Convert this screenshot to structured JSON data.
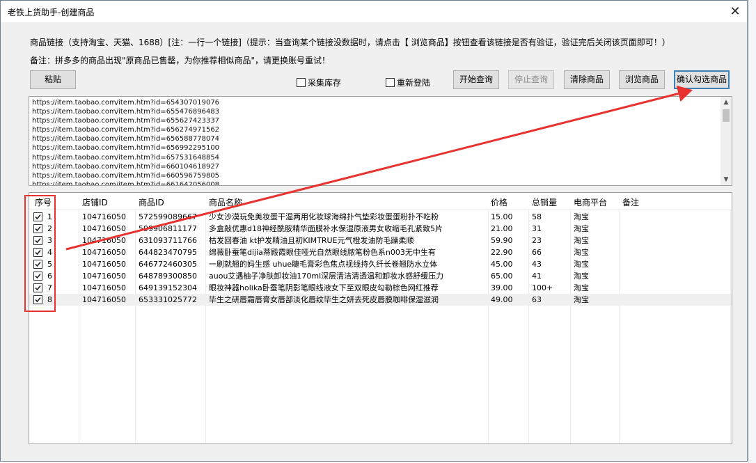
{
  "window": {
    "title": "老铁上货助手-创建商品",
    "close_glyph": "✕"
  },
  "notes": {
    "line1": "商品链接（支持淘宝、天猫、1688）[注：一行一个链接]（提示：当查询某个链接没数据时，请点击【 浏览商品】按钮查看该链接是否有验证，验证完后关闭该页面即可！）",
    "line2": "备注：拼多多的商品出现\"原商品已售罄，为你推荐相似商品\"，请更换账号重试！"
  },
  "toolbar": {
    "paste": "粘贴",
    "collect_stock": "采集库存",
    "relogin": "重新登陆",
    "start_query": "开始查询",
    "stop_query": "停止查询",
    "clear_goods": "清除商品",
    "browse_goods": "浏览商品",
    "confirm_selected": "确认勾选商品"
  },
  "urls": [
    "https://item.taobao.com/item.htm?id=654307019076",
    "https://item.taobao.com/item.htm?id=655476896483",
    "https://item.taobao.com/item.htm?id=655627423337",
    "https://item.taobao.com/item.htm?id=656274971562",
    "https://item.taobao.com/item.htm?id=656588778074",
    "https://item.taobao.com/item.htm?id=656992295100",
    "https://item.taobao.com/item.htm?id=657531648854",
    "https://item.taobao.com/item.htm?id=660104618927",
    "https://item.taobao.com/item.htm?id=660596759805",
    "https://item.taobao.com/item.htm?id=661642056008"
  ],
  "table": {
    "headers": [
      "序号",
      "店铺ID",
      "商品ID",
      "商品名称",
      "价格",
      "总销量",
      "电商平台",
      "备注"
    ],
    "rows": [
      {
        "no": "1",
        "shop": "104716050",
        "item": "572599089667",
        "name": "少女沙漠玩免美妆蛋干湿两用化妆球海绵扑气垫彩妆蛋蛋粉扑不吃粉",
        "price": "15.00",
        "sales": "58",
        "platform": "淘宝",
        "note": ""
      },
      {
        "no": "2",
        "shop": "104716050",
        "item": "599906811177",
        "name": "多盒敲优惠d18神经酰胺精华面膜补水保湿原液男女收缩毛孔紧致5片",
        "price": "21.00",
        "sales": "31",
        "platform": "淘宝",
        "note": ""
      },
      {
        "no": "3",
        "shop": "104716050",
        "item": "631093711766",
        "name": "枯发回春油 kt护发精油且初KIMTRUE元气橙发油防毛躁柔顺",
        "price": "59.90",
        "sales": "23",
        "platform": "淘宝",
        "note": ""
      },
      {
        "no": "4",
        "shop": "104716050",
        "item": "644823470795",
        "name": "绵薇卧蚕笔dijia蒂殿霞眼佳哑光自然眼线脓笔粉色系n003无中生有",
        "price": "22.90",
        "sales": "66",
        "platform": "淘宝",
        "note": ""
      },
      {
        "no": "5",
        "shop": "104716050",
        "item": "646772460305",
        "name": "一刷就翘的妈生感 uhue睫毛膏彩色焦点视线持久纤长卷翘防水立体",
        "price": "45.00",
        "sales": "43",
        "platform": "淘宝",
        "note": ""
      },
      {
        "no": "6",
        "shop": "104716050",
        "item": "648789300850",
        "name": "auou艾遇柚子净肤卸妆油170ml深层清洁清透温和卸妆水感舒缓压力",
        "price": "65.00",
        "sales": "41",
        "platform": "淘宝",
        "note": ""
      },
      {
        "no": "7",
        "shop": "104716050",
        "item": "649139152304",
        "name": "眼妆神器holika卧蚕笔阴影笔眼线液女下至双眼皮勾勒棕色网红推荐",
        "price": "39.00",
        "sales": "100+",
        "platform": "淘宝",
        "note": ""
      },
      {
        "no": "8",
        "shop": "104716050",
        "item": "653331025772",
        "name": "毕生之研唇霜唇膏女唇部淡化唇纹毕生之妍去死皮唇膜咖啡保湿滋润",
        "price": "49.00",
        "sales": "63",
        "platform": "淘宝",
        "note": ""
      }
    ]
  },
  "colors": {
    "annotation": "#e8322f",
    "focus": "#3c7fb1"
  }
}
